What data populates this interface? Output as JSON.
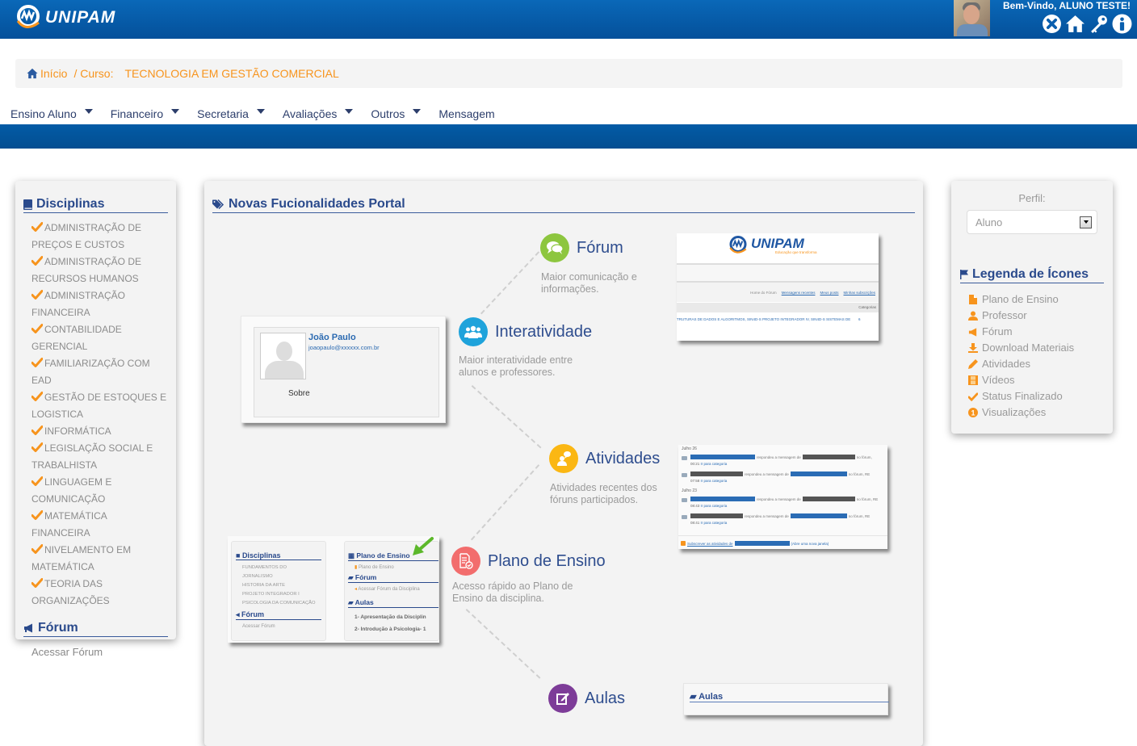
{
  "header": {
    "brand": "UNIPAM",
    "welcome": "Bem-Vindo, ALUNO TESTE!",
    "icons": [
      "close-circle-icon",
      "home-icon",
      "key-icon",
      "info-icon"
    ]
  },
  "breadcrumb": {
    "home": "Início",
    "separator": "/ Curso:",
    "course": "TECNOLOGIA EM GESTÃO COMERCIAL"
  },
  "menu": [
    {
      "label": "Ensino Aluno",
      "dropdown": true
    },
    {
      "label": "Financeiro",
      "dropdown": true
    },
    {
      "label": "Secretaria",
      "dropdown": true
    },
    {
      "label": "Avaliações",
      "dropdown": true
    },
    {
      "label": "Outros",
      "dropdown": true
    },
    {
      "label": "Mensagem",
      "dropdown": false
    }
  ],
  "left_panel": {
    "title": "Disciplinas",
    "disciplines": [
      "ADMINISTRAÇÃO DE PREÇOS E CUSTOS",
      "ADMINISTRAÇÃO DE RECURSOS HUMANOS",
      "ADMINISTRAÇÃO FINANCEIRA",
      "CONTABILIDADE GERENCIAL",
      "FAMILIARIZAÇÃO COM EAD",
      "GESTÃO DE ESTOQUES E LOGISTICA",
      "INFORMÁTICA",
      "LEGISLAÇÃO SOCIAL E TRABALHISTA",
      "LINGUAGEM E COMUNICAÇÃO",
      "MATEMÁTICA FINANCEIRA",
      "NIVELAMENTO EM MATEMÁTICA",
      "TEORIA DAS ORGANIZAÇÕES"
    ],
    "forum_title": "Fórum",
    "forum_link": "Acessar Fórum"
  },
  "center_panel": {
    "title": "Novas Fucionalidades Portal",
    "features": [
      {
        "name": "Fórum",
        "desc": "Maior comunicação e informações.",
        "color": "#8dc63f"
      },
      {
        "name": "Interatividade",
        "desc": "Maior interatividade entre alunos e professores.",
        "color": "#1fa3db"
      },
      {
        "name": "Atividades",
        "desc": "Atividades recentes dos fóruns participados.",
        "color": "#fbb713"
      },
      {
        "name": "Plano de Ensino",
        "desc": "Acesso rápido ao Plano de Ensino da disciplina.",
        "color": "#f26d6d"
      },
      {
        "name": "Aulas",
        "desc": "",
        "color": "#7d3c98"
      }
    ],
    "profile_card": {
      "name": "João Paulo",
      "email": "joaopaulo@xxxxxx.com.br",
      "about": "Sobre"
    },
    "forum_shot": {
      "brand": "UNIPAM",
      "tagline": "Educação que transforma",
      "links": [
        "Home do Fórum",
        "Mensagens recentes",
        "Meus posts",
        "Minhas subscrições"
      ],
      "col_header": "Categorias",
      "row_text": "TRUTURAS DE DADOS E ALGORITMOS, SIN4D-S PROJETO INTEGRADOR IV, SIN4D-S SISTEMAS DE",
      "row_count": "6"
    },
    "activity_shot": {
      "groups": [
        {
          "date": "Julho 26",
          "entries": [
            {
              "action": "respondeu a mensagem de",
              "suffix": "no fórum,",
              "time": "00:21",
              "link": "Ir para categoria"
            },
            {
              "action": "respondeu a mensagem de",
              "suffix": "no fórum, RE",
              "time": "07:58",
              "link": "Ir para categoria"
            }
          ]
        },
        {
          "date": "Julho 23",
          "entries": [
            {
              "action": "respondeu a mensagem de",
              "suffix": "no fórum, RE",
              "time": "08:43",
              "link": "Ir para categoria"
            },
            {
              "action": "respondeu a mensagem de",
              "suffix": "no fórum, RE",
              "time": "08:41",
              "link": "Ir para categoria"
            }
          ]
        }
      ],
      "subscribe": "Subscrever as atividades de",
      "subscribe_suffix": "(Abre uma nova janela)"
    },
    "plan_shot": {
      "left_title": "Disciplinas",
      "left_items": [
        "FUNDAMENTOS DO JORNALISMO",
        "HISTORIA DA ARTE",
        "PROJETO INTEGRADOR I",
        "PSICOLOGIA DA COMUNICAÇÃO"
      ],
      "left_forum": "Fórum",
      "left_forum_link": "Acessar Fórum",
      "right_title": "Plano de Ensino",
      "right_plan_link": "Plano de Ensino",
      "right_forum": "Fórum",
      "right_forum_link": "Acessar Fórum da Disciplina",
      "right_aulas": "Aulas",
      "aulas": [
        "1- Apresentação da Disciplin",
        "2- Introdução à Psicologia- 1"
      ]
    },
    "aulas_shot": {
      "title": "Aulas"
    }
  },
  "right_panel": {
    "perfil_label": "Perfil:",
    "perfil_value": "Aluno",
    "legend_title": "Legenda de Ícones",
    "legend": [
      {
        "label": "Plano de Ensino",
        "icon": "file-icon"
      },
      {
        "label": "Professor",
        "icon": "user-icon"
      },
      {
        "label": "Fórum",
        "icon": "bullhorn-icon"
      },
      {
        "label": "Download Materiais",
        "icon": "download-icon"
      },
      {
        "label": "Atividades",
        "icon": "pencil-icon"
      },
      {
        "label": "Vídeos",
        "icon": "film-icon"
      },
      {
        "label": "Status Finalizado",
        "icon": "check-icon"
      },
      {
        "label": "Visualizações",
        "icon": "badge-icon",
        "badge": "1"
      }
    ],
    "accent": "#f7941d"
  }
}
